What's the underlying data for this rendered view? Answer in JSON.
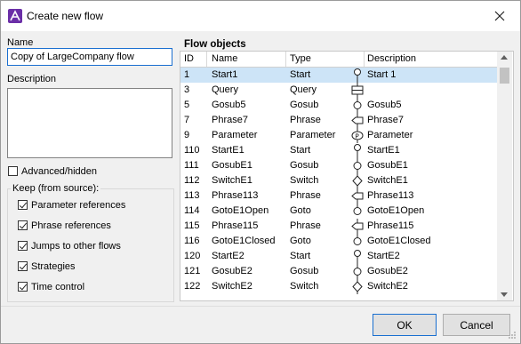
{
  "window": {
    "title": "Create new flow"
  },
  "left": {
    "name_label": "Name",
    "name_value": "Copy of LargeCompany flow",
    "description_label": "Description",
    "advanced_label": "Advanced/hidden",
    "advanced_checked": false,
    "keep_group_label": "Keep (from source):",
    "keep_options": [
      {
        "label": "Parameter references",
        "checked": true
      },
      {
        "label": "Phrase references",
        "checked": true
      },
      {
        "label": "Jumps to other flows",
        "checked": true
      },
      {
        "label": "Strategies",
        "checked": true
      },
      {
        "label": "Time control",
        "checked": true
      }
    ]
  },
  "flow_objects": {
    "title": "Flow objects",
    "columns": [
      "ID",
      "Name",
      "Type",
      "Description"
    ],
    "rows": [
      {
        "id": "1",
        "name": "Start1",
        "type": "Start",
        "glyph": "start-icon",
        "description": "Start 1",
        "selected": true
      },
      {
        "id": "3",
        "name": "Query",
        "type": "Query",
        "glyph": "query-icon",
        "description": "",
        "selected": false
      },
      {
        "id": "5",
        "name": "Gosub5",
        "type": "Gosub",
        "glyph": "gosub-icon",
        "description": "Gosub5",
        "selected": false
      },
      {
        "id": "7",
        "name": "Phrase7",
        "type": "Phrase",
        "glyph": "phrase-icon",
        "description": "Phrase7",
        "selected": false
      },
      {
        "id": "9",
        "name": "Parameter",
        "type": "Parameter",
        "glyph": "parameter-icon",
        "description": "Parameter",
        "selected": false
      },
      {
        "id": "110",
        "name": "StartE1",
        "type": "Start",
        "glyph": "start-icon",
        "description": "StartE1",
        "selected": false
      },
      {
        "id": "111",
        "name": "GosubE1",
        "type": "Gosub",
        "glyph": "gosub-icon",
        "description": "GosubE1",
        "selected": false
      },
      {
        "id": "112",
        "name": "SwitchE1",
        "type": "Switch",
        "glyph": "switch-icon",
        "description": "SwitchE1",
        "selected": false
      },
      {
        "id": "113",
        "name": "Phrase113",
        "type": "Phrase",
        "glyph": "phrase-icon",
        "description": "Phrase113",
        "selected": false
      },
      {
        "id": "114",
        "name": "GotoE1Open",
        "type": "Goto",
        "glyph": "goto-icon",
        "description": "GotoE1Open",
        "selected": false
      },
      {
        "id": "115",
        "name": "Phrase115",
        "type": "Phrase",
        "glyph": "phrase-icon",
        "description": "Phrase115",
        "selected": false
      },
      {
        "id": "116",
        "name": "GotoE1Closed",
        "type": "Goto",
        "glyph": "goto-icon",
        "description": "GotoE1Closed",
        "selected": false
      },
      {
        "id": "120",
        "name": "StartE2",
        "type": "Start",
        "glyph": "start-icon",
        "description": "StartE2",
        "selected": false
      },
      {
        "id": "121",
        "name": "GosubE2",
        "type": "Gosub",
        "glyph": "gosub-icon",
        "description": "GosubE2",
        "selected": false
      },
      {
        "id": "122",
        "name": "SwitchE2",
        "type": "Switch",
        "glyph": "switch-icon",
        "description": "SwitchE2",
        "selected": false
      }
    ]
  },
  "buttons": {
    "ok": "OK",
    "cancel": "Cancel"
  },
  "colors": {
    "accent": "#1a6fd0",
    "selection": "#cde4f7",
    "app_icon": "#6b2fa7"
  }
}
